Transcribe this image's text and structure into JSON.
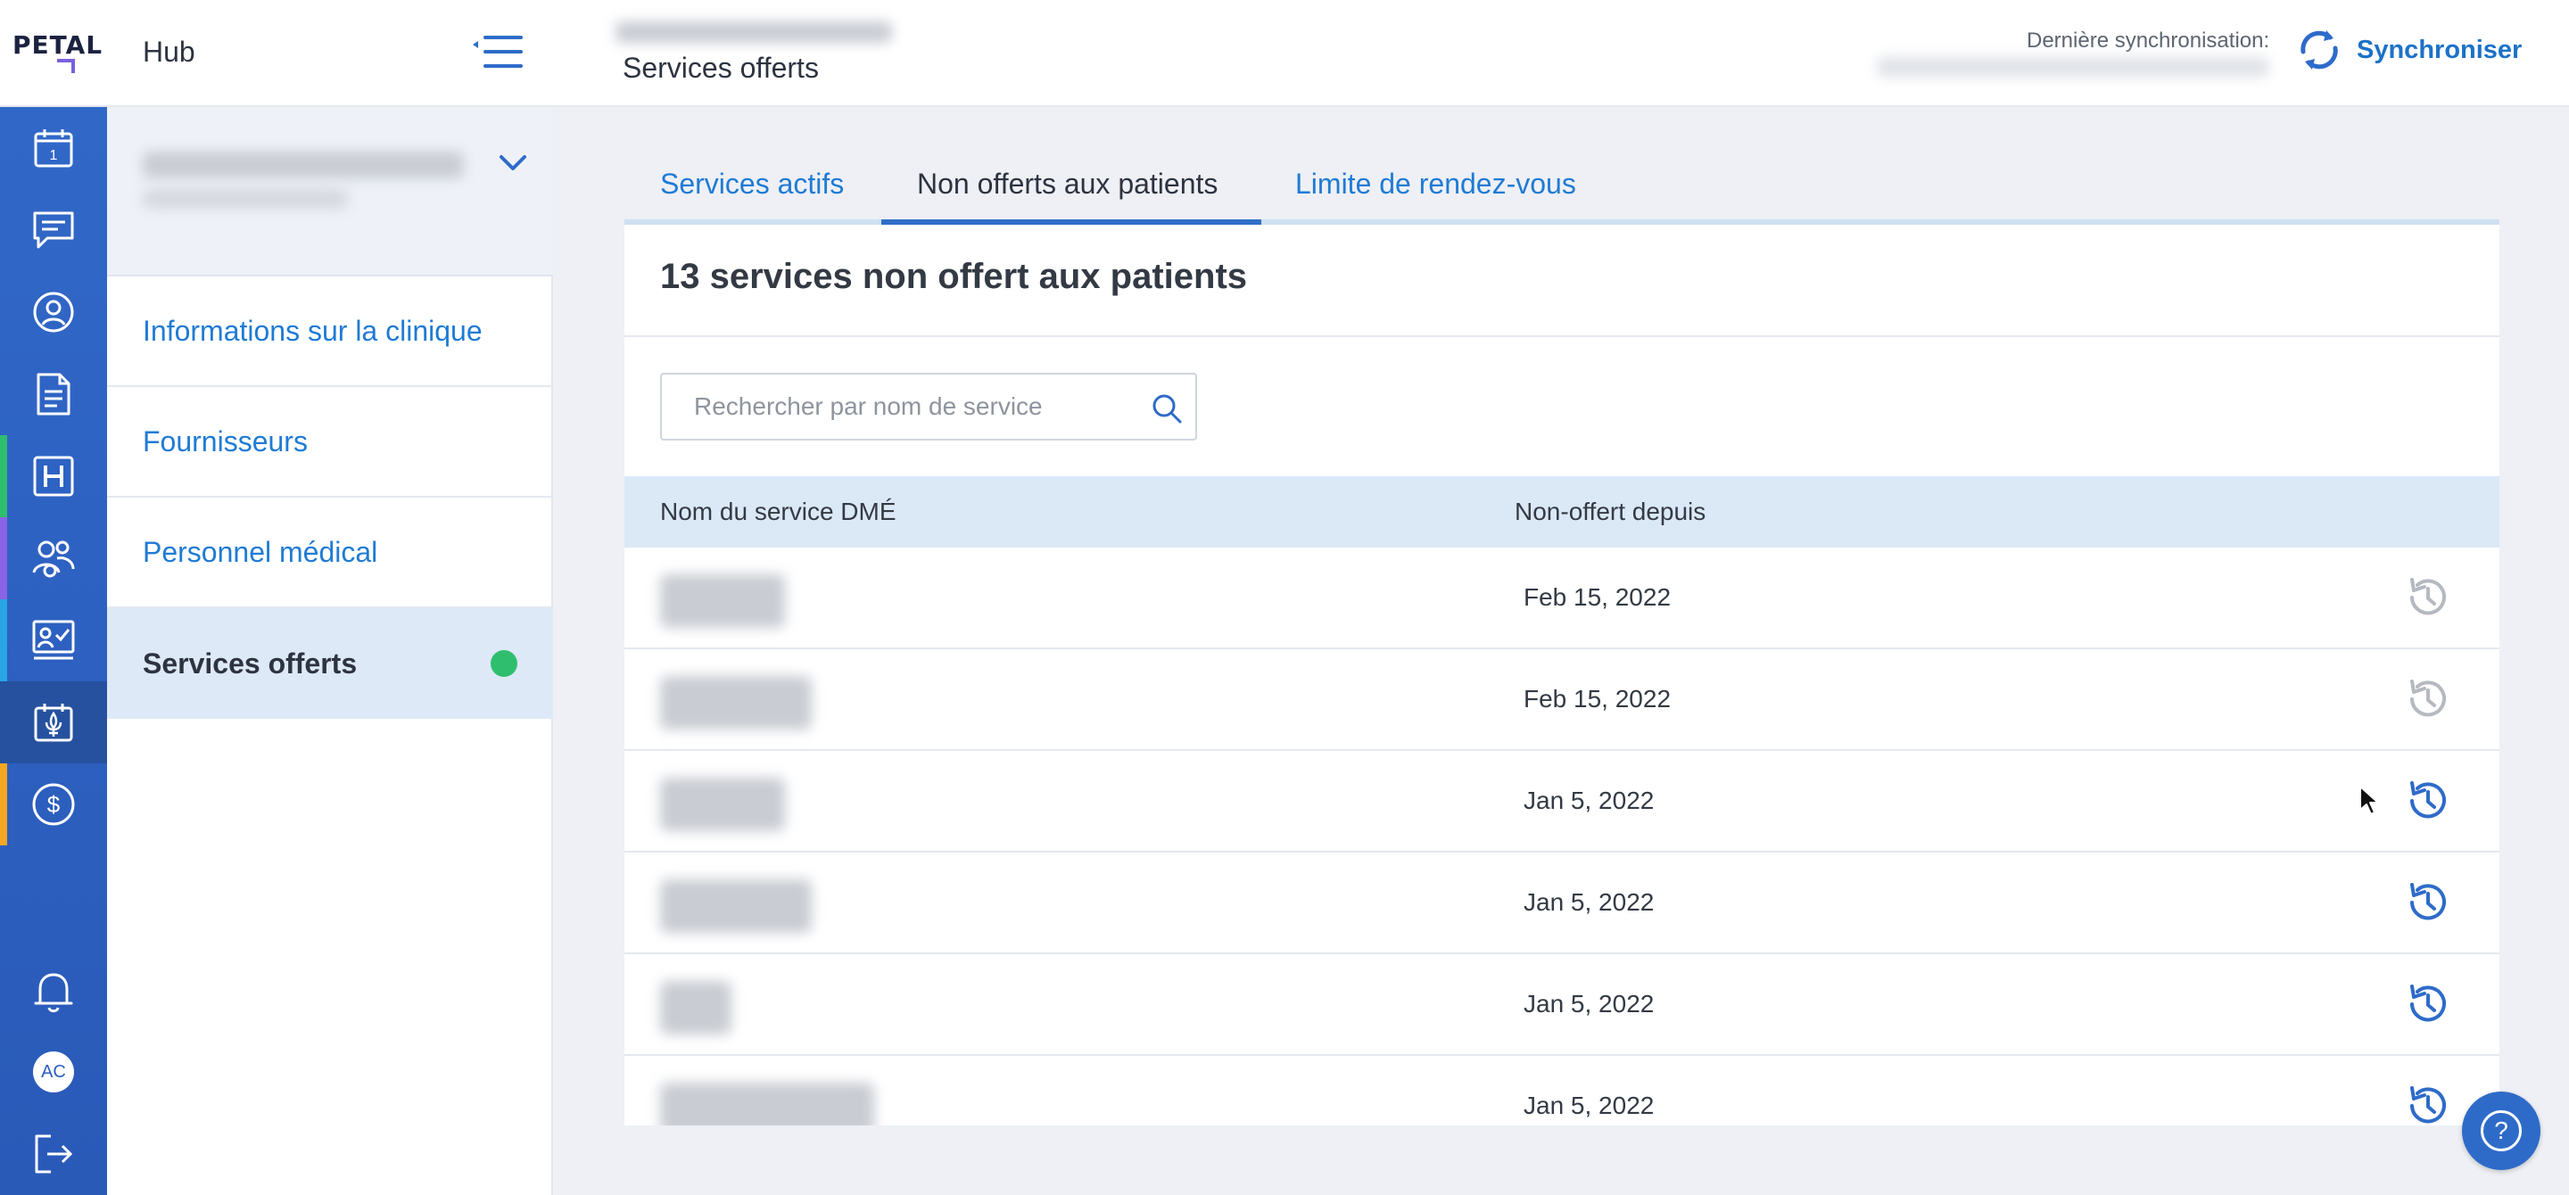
{
  "header": {
    "brand": "PETAL",
    "app_name": "Hub",
    "page_title": "Services offerts",
    "last_sync_label": "Dernière synchronisation:",
    "sync_button_label": "Synchroniser"
  },
  "rail": {
    "calendar_day": "1",
    "avatar_initials": "AC",
    "icons": [
      "calendar-icon",
      "messages-icon",
      "patient-icon",
      "document-icon",
      "hospital-icon",
      "team-icon",
      "checklist-board-icon",
      "quebec-calendar-icon",
      "billing-icon",
      "bell-icon",
      "avatar",
      "logout-icon"
    ],
    "accent_colors": {
      "hospital": "#2fbe6e",
      "team": "#8a63e6",
      "checklist": "#2aa5e6",
      "billing": "#f5a623"
    }
  },
  "subnav": {
    "items": [
      {
        "label": "Informations sur la clinique"
      },
      {
        "label": "Fournisseurs"
      },
      {
        "label": "Personnel médical"
      },
      {
        "label": "Services offerts"
      }
    ]
  },
  "tabs": [
    {
      "label": "Services actifs"
    },
    {
      "label": "Non offerts aux patients"
    },
    {
      "label": "Limite de rendez-vous"
    }
  ],
  "main": {
    "title": "13 services non offert aux patients",
    "search_placeholder": "Rechercher par nom de service",
    "columns": [
      "Nom du service DMÉ",
      "Non-offert depuis"
    ],
    "rows": [
      {
        "date": "Feb 15, 2022",
        "restore_enabled": false
      },
      {
        "date": "Feb 15, 2022",
        "restore_enabled": false
      },
      {
        "date": "Jan 5, 2022",
        "restore_enabled": true
      },
      {
        "date": "Jan 5, 2022",
        "restore_enabled": true
      },
      {
        "date": "Jan 5, 2022",
        "restore_enabled": true
      },
      {
        "date": "Jan 5, 2022",
        "restore_enabled": true
      }
    ]
  },
  "colors": {
    "accent_blue": "#1f7bd4",
    "rail_blue": "#2c5fbf",
    "status_green": "#2fbe6e",
    "restore_disabled": "#b5b9c0",
    "restore_enabled": "#2e6bc9"
  },
  "help": {
    "icon": "question-icon",
    "glyph": "?"
  }
}
